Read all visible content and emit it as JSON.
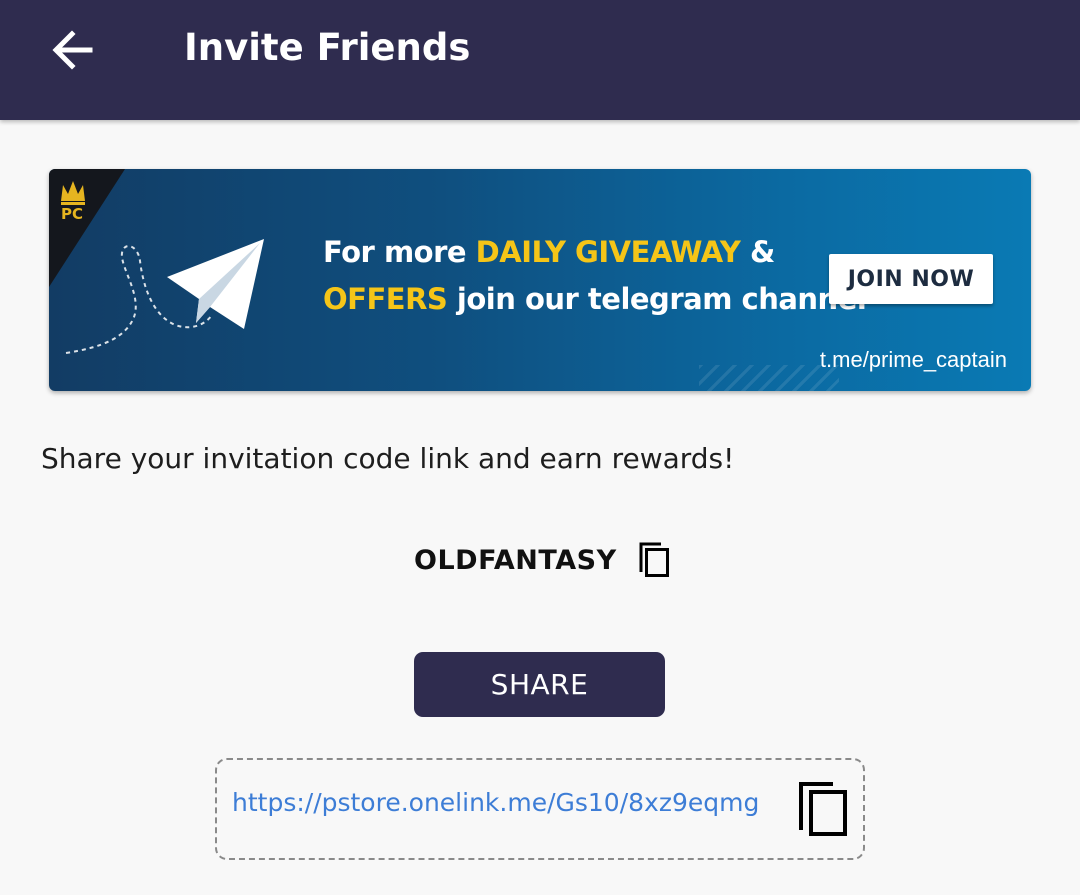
{
  "appbar": {
    "title": "Invite Friends",
    "back_icon": "arrow-left-icon",
    "background": "#2f2c4f"
  },
  "banner": {
    "logo_text": "PC",
    "line1_prefix": "For more ",
    "line1_highlight": "DAILY GIVEAWAY",
    "line1_suffix": " &",
    "line2_highlight": "OFFERS",
    "line2_suffix": " join our telegram channel",
    "join_label": "JOIN NOW",
    "telegram_url": "t.me/prime_captain",
    "highlight_color": "#f5c518"
  },
  "main": {
    "tagline": "Share your invitation code link and earn rewards!",
    "invite_code": "OLDFANTASY",
    "share_label": "SHARE",
    "invite_link": "https://pstore.onelink.me/Gs10/8xz9eqmg",
    "link_color": "#3d7dd6"
  }
}
